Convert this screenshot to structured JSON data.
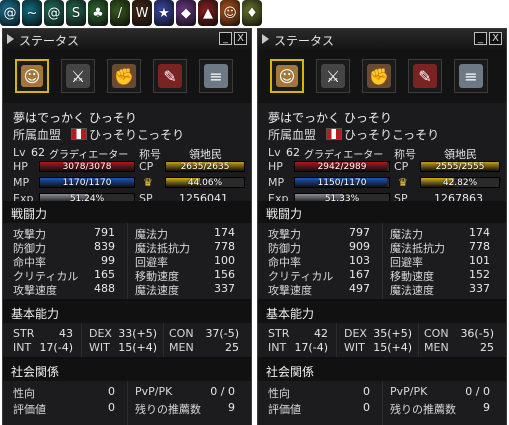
{
  "buffs": [
    {
      "icon": "buff-swirl-icon",
      "color": "#1a7ea3"
    },
    {
      "icon": "buff-wave-icon",
      "color": "#0f6f83"
    },
    {
      "icon": "buff-spiral-icon",
      "color": "#1e7a66"
    },
    {
      "icon": "buff-snake-icon",
      "color": "#246d52"
    },
    {
      "icon": "buff-vine-icon",
      "color": "#2b6d2f"
    },
    {
      "icon": "buff-feather-icon",
      "color": "#3a5d1f"
    },
    {
      "icon": "buff-wolf-icon",
      "color": "#4a2c1a"
    },
    {
      "icon": "buff-star-icon",
      "color": "#3b4bb2"
    },
    {
      "icon": "buff-shield-icon",
      "color": "#6f3a8a"
    },
    {
      "icon": "buff-flame-icon",
      "color": "#8a2020"
    },
    {
      "icon": "buff-mask-icon",
      "color": "#c45a1a"
    },
    {
      "icon": "buff-potion-icon",
      "color": "#6d7a2b"
    }
  ],
  "panels": [
    {
      "window": {
        "title": "ステータス",
        "minimize": "_",
        "close": "X"
      },
      "tabs": [
        "character",
        "skills",
        "actions",
        "quests",
        "ranking"
      ],
      "header": {
        "name": "夢はでっかく ひっそり",
        "clan_label": "所属血盟",
        "clan_name": "ひっそりこっそり",
        "lv_label": "Lv",
        "lv": "62",
        "class": "グラディエーター",
        "title_label": "称号",
        "title": "領地民",
        "hp_label": "HP",
        "hp_text": "3078/3078",
        "hp_fill": 1.0,
        "mp_label": "MP",
        "mp_text": "1170/1170",
        "mp_fill": 1.0,
        "exp_label": "Exp",
        "exp_text": "51.24%",
        "exp_fill": 0.5124,
        "cp_label": "CP",
        "cp_text": "2635/2635",
        "cp_fill": 1.0,
        "sp_label": "SP",
        "sp": "1256041",
        "vit_text": "44.06%",
        "vit_fill": 0.4406
      },
      "combat": {
        "title": "戦闘力",
        "rows": [
          [
            "攻撃力",
            "791",
            "魔法力",
            "174"
          ],
          [
            "防御力",
            "839",
            "魔法抵抗力",
            "778"
          ],
          [
            "命中率",
            "99",
            "回避率",
            "100"
          ],
          [
            "クリティカル",
            "165",
            "移動速度",
            "156"
          ],
          [
            "攻撃速度",
            "488",
            "魔法速度",
            "337"
          ]
        ]
      },
      "basic": {
        "title": "基本能力",
        "rows": [
          [
            "STR",
            "43",
            "DEX",
            "33(+5)",
            "CON",
            "37(-5)"
          ],
          [
            "INT",
            "17(-4)",
            "WIT",
            "15(+4)",
            "MEN",
            "25"
          ]
        ]
      },
      "social": {
        "title": "社会関係",
        "rows": [
          [
            "性向",
            "0",
            "PvP/PK",
            "0 / 0"
          ],
          [
            "評価値",
            "0",
            "残りの推薦数",
            "9"
          ]
        ]
      }
    },
    {
      "window": {
        "title": "ステータス",
        "minimize": "_",
        "close": "X"
      },
      "tabs": [
        "character",
        "skills",
        "actions",
        "quests",
        "ranking"
      ],
      "header": {
        "name": "夢はでっかく ひっそり",
        "clan_label": "所属血盟",
        "clan_name": "ひっそりこっそり",
        "lv_label": "Lv",
        "lv": "62",
        "class": "グラディエーター",
        "title_label": "称号",
        "title": "領地民",
        "hp_label": "HP",
        "hp_text": "2942/2989",
        "hp_fill": 0.984,
        "mp_label": "MP",
        "mp_text": "1150/1170",
        "mp_fill": 0.983,
        "exp_label": "Exp",
        "exp_text": "51.33%",
        "exp_fill": 0.5133,
        "cp_label": "CP",
        "cp_text": "2555/2555",
        "cp_fill": 1.0,
        "sp_label": "SP",
        "sp": "1267863",
        "vit_text": "42.82%",
        "vit_fill": 0.4282
      },
      "combat": {
        "title": "戦闘力",
        "rows": [
          [
            "攻撃力",
            "797",
            "魔法力",
            "174"
          ],
          [
            "防御力",
            "909",
            "魔法抵抗力",
            "778"
          ],
          [
            "命中率",
            "103",
            "回避率",
            "101"
          ],
          [
            "クリティカル",
            "167",
            "移動速度",
            "152"
          ],
          [
            "攻撃速度",
            "497",
            "魔法速度",
            "337"
          ]
        ]
      },
      "basic": {
        "title": "基本能力",
        "rows": [
          [
            "STR",
            "42",
            "DEX",
            "35(+5)",
            "CON",
            "36(-5)"
          ],
          [
            "INT",
            "17(-4)",
            "WIT",
            "15(+4)",
            "MEN",
            "25"
          ]
        ]
      },
      "social": {
        "title": "社会関係",
        "rows": [
          [
            "性向",
            "0",
            "PvP/PK",
            "0 / 0"
          ],
          [
            "評価値",
            "0",
            "残りの推薦数",
            "9"
          ]
        ]
      }
    }
  ],
  "colors": {
    "hp": "#b0161a",
    "mp": "#2055b8",
    "exp": "#8e8e9a",
    "cp": "#c89b16",
    "vit": "#d2a81a",
    "tab_active": "#d8b500"
  }
}
